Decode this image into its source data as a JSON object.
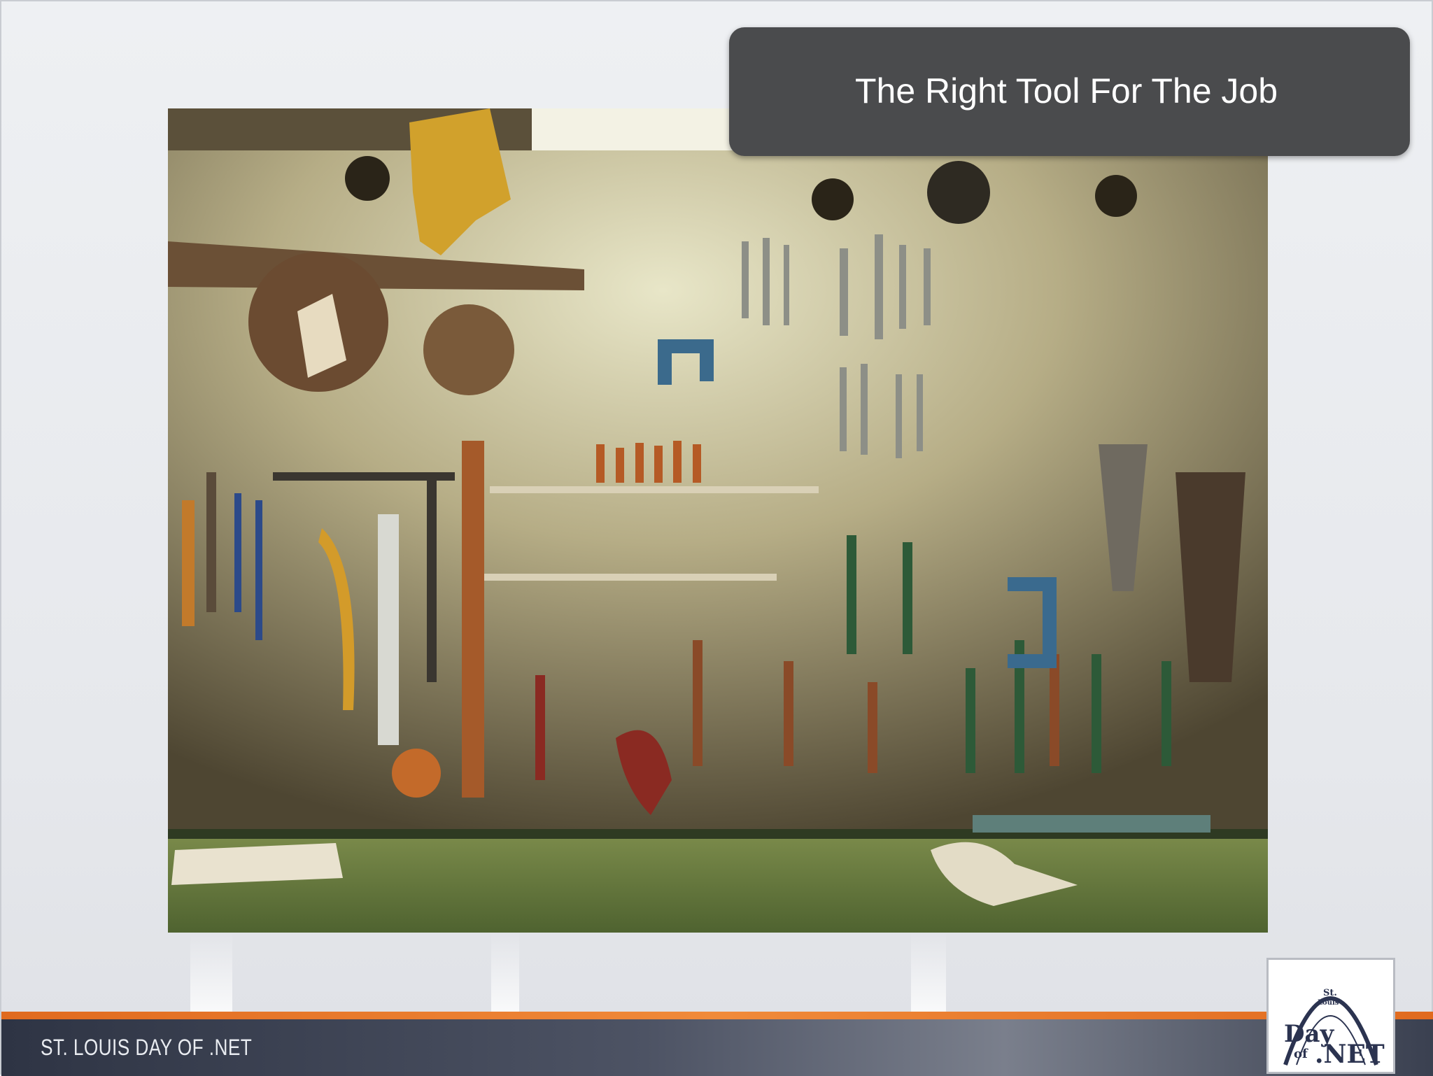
{
  "slide": {
    "title": "The Right Tool For The Job",
    "footer_text": "ST. LOUIS DAY OF .NET",
    "photo_icon": "tool-wall-photo",
    "logo": {
      "st": "St.",
      "louis": "Louis",
      "day": "Day",
      "of": "of",
      "net": ".NET"
    }
  },
  "colors": {
    "title_box": "#4a4b4d",
    "footer_orange": "#e06a1f",
    "footer_bar": "#3a4050"
  }
}
